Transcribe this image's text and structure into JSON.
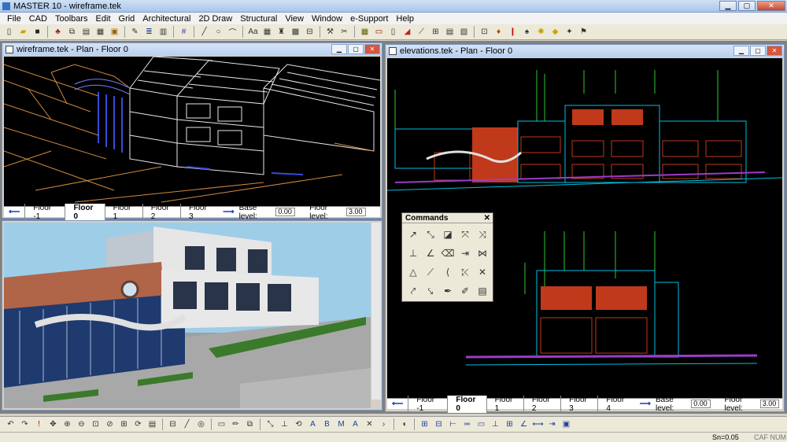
{
  "app": {
    "title": "MASTER 10 - wireframe.tek"
  },
  "menu": [
    "File",
    "CAD",
    "Toolbars",
    "Edit",
    "Grid",
    "Architectural",
    "2D Draw",
    "Structural",
    "View",
    "Window",
    "e-Support",
    "Help"
  ],
  "windows": {
    "wireframe": {
      "title": "wireframe.tek - Plan - Floor 0",
      "floors": [
        "Floor -1",
        "Floor 0",
        "Floor 1",
        "Floor 2",
        "Floor 3"
      ],
      "active_floor": "Floor 0",
      "base_label": "Base level:",
      "base_value": "0.00",
      "floor_label": "Floor level:",
      "floor_value": "3.00"
    },
    "elevations": {
      "title": "elevations.tek - Plan - Floor 0",
      "floors": [
        "Floor -1",
        "Floor 0",
        "Floor 1",
        "Floor 2",
        "Floor 3",
        "Floor 4"
      ],
      "active_floor": "Floor 0",
      "base_label": "Base level:",
      "base_value": "0.00",
      "floor_label": "Floor level:",
      "floor_value": "3.00"
    }
  },
  "commands": {
    "title": "Commands",
    "close": "✕"
  },
  "status": {
    "snap": "Sn=0.05",
    "caps": "CAF NUM"
  },
  "colors": {
    "cad_bg": "#000000",
    "cyan": "#00bfe0",
    "red": "#c0391a",
    "green": "#2ec82e",
    "purple": "#9a3cc8",
    "sky": "#9ecde8"
  }
}
